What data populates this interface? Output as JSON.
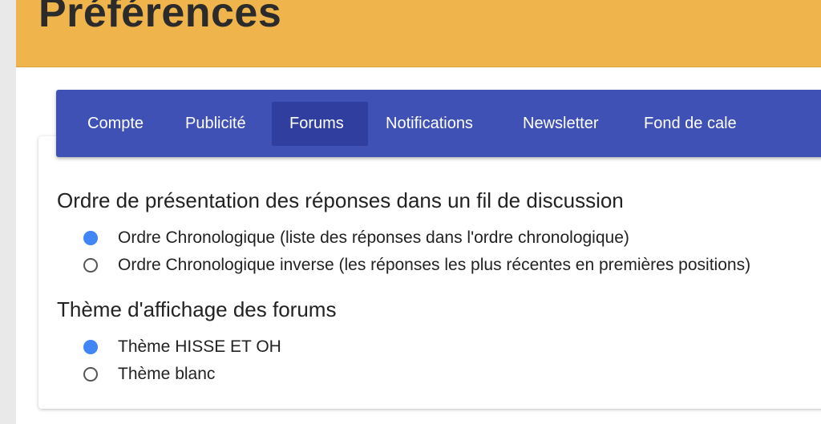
{
  "page": {
    "title": "Préférences"
  },
  "nav": {
    "tabs": [
      {
        "label": "Compte",
        "active": false
      },
      {
        "label": "Publicité",
        "active": false
      },
      {
        "label": "Forums",
        "active": true
      },
      {
        "label": "Notifications",
        "active": false
      },
      {
        "label": "Newsletter",
        "active": false
      },
      {
        "label": "Fond de cale",
        "active": false
      }
    ]
  },
  "sections": [
    {
      "title": "Ordre de présentation des réponses dans un fil de discussion",
      "options": [
        {
          "label": "Ordre Chronologique (liste des réponses dans l'ordre chronologique)",
          "checked": true
        },
        {
          "label": "Ordre Chronologique inverse (les réponses les plus récentes en premières positions)",
          "checked": false
        }
      ]
    },
    {
      "title": "Thème d'affichage des forums",
      "options": [
        {
          "label": "Thème HISSE ET OH",
          "checked": true
        },
        {
          "label": "Thème blanc",
          "checked": false
        }
      ]
    }
  ],
  "colors": {
    "header": "#f0b44d",
    "nav": "#3f51b5",
    "nav_active": "#303f9f",
    "radio_checked": "#4285f4"
  }
}
